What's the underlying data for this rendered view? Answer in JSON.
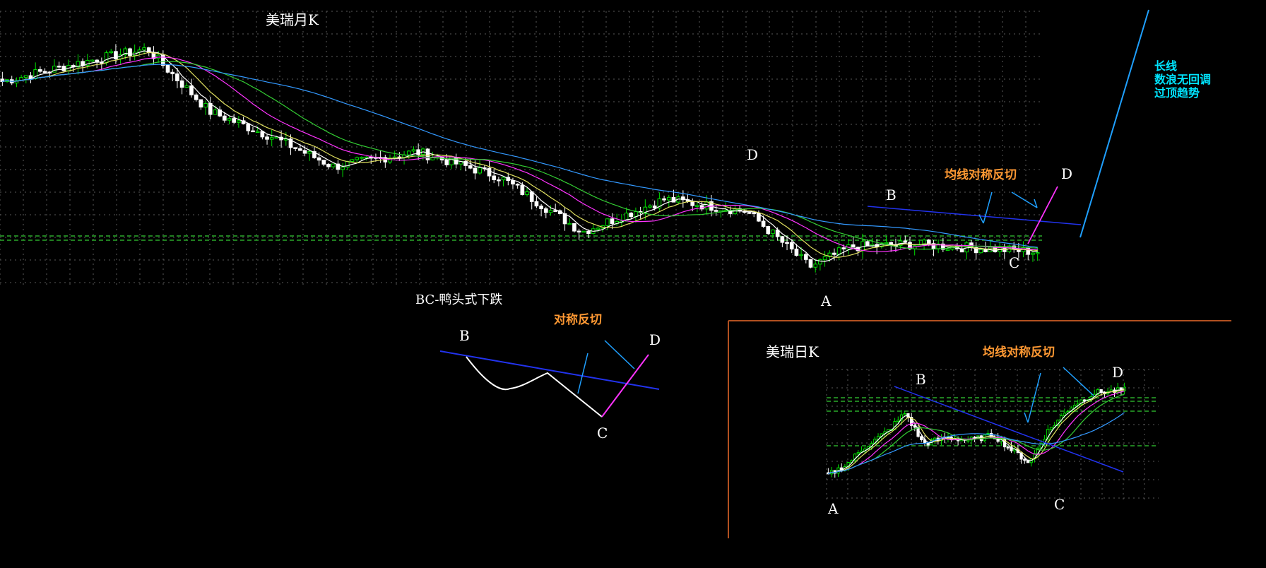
{
  "monthly": {
    "title": "美瑞月K",
    "points": {
      "A": "A",
      "B": "B",
      "C": "C",
      "D": "D"
    },
    "annotation_ma": "均线对称反切",
    "annotation_long": [
      "长线",
      "数浪无回调",
      "过顶趋势"
    ]
  },
  "diagram": {
    "title": "BC-鸭头式下跌",
    "points": {
      "B": "B",
      "C": "C",
      "D": "D"
    },
    "annotation": "对称反切"
  },
  "daily": {
    "title": "美瑞日K",
    "points": {
      "A": "A",
      "B": "B",
      "C": "C",
      "D": "D"
    },
    "annotation_ma": "均线对称反切"
  },
  "colors": {
    "background": "#000000",
    "candle_up": "#00dd00",
    "candle_down": "#ffffff",
    "ma5": "#ffffff",
    "ma10": "#e0e060",
    "ma20": "#ff33ff",
    "ma30": "#33cc33",
    "ma60": "#3399ff",
    "trendline": "#2233ee",
    "annotation_blue": "#1fa0ff",
    "annotation_magenta": "#ff33ff",
    "support": "#33cc33",
    "frame": "#b25020"
  },
  "chart_data": [
    {
      "type": "candlestick",
      "name": "monthly",
      "title": "美瑞月K",
      "ylim": [
        0,
        100
      ],
      "close_trend": [
        {
          "x": 0,
          "y": 72
        },
        {
          "x": 8,
          "y": 80
        },
        {
          "x": 14,
          "y": 85
        },
        {
          "x": 20,
          "y": 60
        },
        {
          "x": 26,
          "y": 50
        },
        {
          "x": 32,
          "y": 38
        },
        {
          "x": 40,
          "y": 44
        },
        {
          "x": 48,
          "y": 34
        },
        {
          "x": 56,
          "y": 12
        },
        {
          "x": 64,
          "y": 25
        },
        {
          "x": 72,
          "y": 20
        },
        {
          "x": 78,
          "y": -2
        },
        {
          "x": 82,
          "y": 6
        },
        {
          "x": 88,
          "y": 7
        },
        {
          "x": 96,
          "y": 5
        },
        {
          "x": 100,
          "y": 4
        }
      ],
      "moving_averages": [
        "MA5",
        "MA10",
        "MA20",
        "MA30",
        "MA60"
      ],
      "labels": [
        "A",
        "B",
        "C",
        "D",
        "均线对称反切",
        "长线",
        "数浪无回调",
        "过顶趋势"
      ]
    },
    {
      "type": "line",
      "name": "diagram",
      "title": "BC-鸭头式下跌",
      "points": [
        {
          "label": "B",
          "x": 0,
          "y": 10
        },
        {
          "x": 3,
          "y": 6
        },
        {
          "x": 6,
          "y": 7
        },
        {
          "label": "C",
          "x": 10,
          "y": 0
        },
        {
          "label": "D",
          "x": 14,
          "y": 9
        }
      ],
      "labels": [
        "对称反切"
      ]
    },
    {
      "type": "candlestick",
      "name": "daily",
      "title": "美瑞日K",
      "ylim": [
        0,
        100
      ],
      "close_trend": [
        {
          "x": 0,
          "y": 20
        },
        {
          "x": 6,
          "y": 28
        },
        {
          "x": 12,
          "y": 42
        },
        {
          "x": 20,
          "y": 55
        },
        {
          "x": 26,
          "y": 70
        },
        {
          "x": 32,
          "y": 45
        },
        {
          "x": 40,
          "y": 50
        },
        {
          "x": 48,
          "y": 48
        },
        {
          "x": 56,
          "y": 52
        },
        {
          "x": 62,
          "y": 40
        },
        {
          "x": 68,
          "y": 30
        },
        {
          "x": 74,
          "y": 55
        },
        {
          "x": 82,
          "y": 75
        },
        {
          "x": 90,
          "y": 86
        },
        {
          "x": 100,
          "y": 88
        }
      ],
      "labels": [
        "A",
        "B",
        "C",
        "D",
        "均线对称反切"
      ]
    }
  ]
}
